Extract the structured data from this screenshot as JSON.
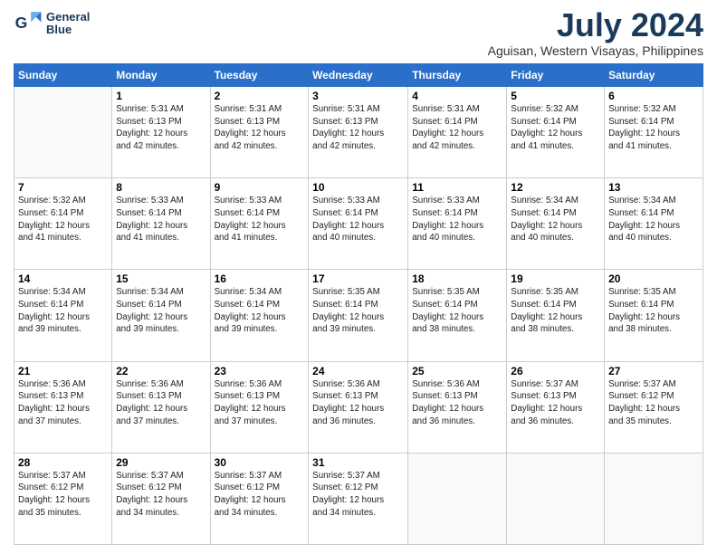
{
  "logo": {
    "line1": "General",
    "line2": "Blue"
  },
  "title": "July 2024",
  "location": "Aguisan, Western Visayas, Philippines",
  "days_of_week": [
    "Sunday",
    "Monday",
    "Tuesday",
    "Wednesday",
    "Thursday",
    "Friday",
    "Saturday"
  ],
  "weeks": [
    [
      {
        "day": "",
        "info": ""
      },
      {
        "day": "1",
        "info": "Sunrise: 5:31 AM\nSunset: 6:13 PM\nDaylight: 12 hours\nand 42 minutes."
      },
      {
        "day": "2",
        "info": "Sunrise: 5:31 AM\nSunset: 6:13 PM\nDaylight: 12 hours\nand 42 minutes."
      },
      {
        "day": "3",
        "info": "Sunrise: 5:31 AM\nSunset: 6:13 PM\nDaylight: 12 hours\nand 42 minutes."
      },
      {
        "day": "4",
        "info": "Sunrise: 5:31 AM\nSunset: 6:14 PM\nDaylight: 12 hours\nand 42 minutes."
      },
      {
        "day": "5",
        "info": "Sunrise: 5:32 AM\nSunset: 6:14 PM\nDaylight: 12 hours\nand 41 minutes."
      },
      {
        "day": "6",
        "info": "Sunrise: 5:32 AM\nSunset: 6:14 PM\nDaylight: 12 hours\nand 41 minutes."
      }
    ],
    [
      {
        "day": "7",
        "info": "Sunrise: 5:32 AM\nSunset: 6:14 PM\nDaylight: 12 hours\nand 41 minutes."
      },
      {
        "day": "8",
        "info": "Sunrise: 5:33 AM\nSunset: 6:14 PM\nDaylight: 12 hours\nand 41 minutes."
      },
      {
        "day": "9",
        "info": "Sunrise: 5:33 AM\nSunset: 6:14 PM\nDaylight: 12 hours\nand 41 minutes."
      },
      {
        "day": "10",
        "info": "Sunrise: 5:33 AM\nSunset: 6:14 PM\nDaylight: 12 hours\nand 40 minutes."
      },
      {
        "day": "11",
        "info": "Sunrise: 5:33 AM\nSunset: 6:14 PM\nDaylight: 12 hours\nand 40 minutes."
      },
      {
        "day": "12",
        "info": "Sunrise: 5:34 AM\nSunset: 6:14 PM\nDaylight: 12 hours\nand 40 minutes."
      },
      {
        "day": "13",
        "info": "Sunrise: 5:34 AM\nSunset: 6:14 PM\nDaylight: 12 hours\nand 40 minutes."
      }
    ],
    [
      {
        "day": "14",
        "info": "Sunrise: 5:34 AM\nSunset: 6:14 PM\nDaylight: 12 hours\nand 39 minutes."
      },
      {
        "day": "15",
        "info": "Sunrise: 5:34 AM\nSunset: 6:14 PM\nDaylight: 12 hours\nand 39 minutes."
      },
      {
        "day": "16",
        "info": "Sunrise: 5:34 AM\nSunset: 6:14 PM\nDaylight: 12 hours\nand 39 minutes."
      },
      {
        "day": "17",
        "info": "Sunrise: 5:35 AM\nSunset: 6:14 PM\nDaylight: 12 hours\nand 39 minutes."
      },
      {
        "day": "18",
        "info": "Sunrise: 5:35 AM\nSunset: 6:14 PM\nDaylight: 12 hours\nand 38 minutes."
      },
      {
        "day": "19",
        "info": "Sunrise: 5:35 AM\nSunset: 6:14 PM\nDaylight: 12 hours\nand 38 minutes."
      },
      {
        "day": "20",
        "info": "Sunrise: 5:35 AM\nSunset: 6:14 PM\nDaylight: 12 hours\nand 38 minutes."
      }
    ],
    [
      {
        "day": "21",
        "info": "Sunrise: 5:36 AM\nSunset: 6:13 PM\nDaylight: 12 hours\nand 37 minutes."
      },
      {
        "day": "22",
        "info": "Sunrise: 5:36 AM\nSunset: 6:13 PM\nDaylight: 12 hours\nand 37 minutes."
      },
      {
        "day": "23",
        "info": "Sunrise: 5:36 AM\nSunset: 6:13 PM\nDaylight: 12 hours\nand 37 minutes."
      },
      {
        "day": "24",
        "info": "Sunrise: 5:36 AM\nSunset: 6:13 PM\nDaylight: 12 hours\nand 36 minutes."
      },
      {
        "day": "25",
        "info": "Sunrise: 5:36 AM\nSunset: 6:13 PM\nDaylight: 12 hours\nand 36 minutes."
      },
      {
        "day": "26",
        "info": "Sunrise: 5:37 AM\nSunset: 6:13 PM\nDaylight: 12 hours\nand 36 minutes."
      },
      {
        "day": "27",
        "info": "Sunrise: 5:37 AM\nSunset: 6:12 PM\nDaylight: 12 hours\nand 35 minutes."
      }
    ],
    [
      {
        "day": "28",
        "info": "Sunrise: 5:37 AM\nSunset: 6:12 PM\nDaylight: 12 hours\nand 35 minutes."
      },
      {
        "day": "29",
        "info": "Sunrise: 5:37 AM\nSunset: 6:12 PM\nDaylight: 12 hours\nand 34 minutes."
      },
      {
        "day": "30",
        "info": "Sunrise: 5:37 AM\nSunset: 6:12 PM\nDaylight: 12 hours\nand 34 minutes."
      },
      {
        "day": "31",
        "info": "Sunrise: 5:37 AM\nSunset: 6:12 PM\nDaylight: 12 hours\nand 34 minutes."
      },
      {
        "day": "",
        "info": ""
      },
      {
        "day": "",
        "info": ""
      },
      {
        "day": "",
        "info": ""
      }
    ]
  ]
}
